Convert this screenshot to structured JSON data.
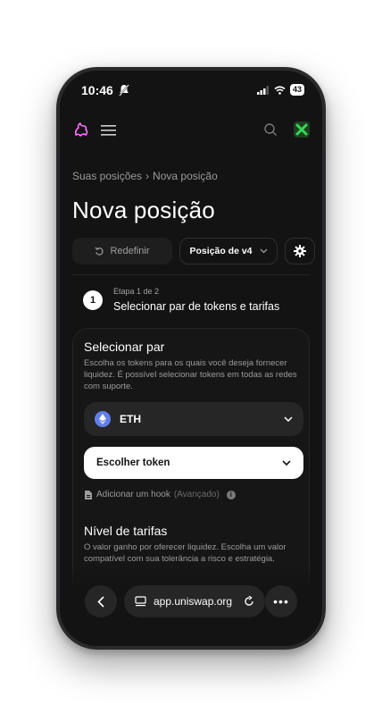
{
  "status": {
    "time": "10:46",
    "battery": "43"
  },
  "breadcrumb": {
    "parent": "Suas posições",
    "separator": "›",
    "current": "Nova posição"
  },
  "page_title": "Nova posição",
  "actions": {
    "reset_label": "Redefinir",
    "version_label": "Posição de v4"
  },
  "step": {
    "number": "1",
    "label": "Etapa 1 de 2",
    "name": "Selecionar par de tokens e tarifas"
  },
  "pair_section": {
    "heading": "Selecionar par",
    "description": "Escolha os tokens para os quais você deseja fornecer liquidez. É possível selecionar tokens em todas as redes com suporte.",
    "token_a": "ETH",
    "token_b_placeholder": "Escolher token",
    "hook_label": "Adicionar um hook",
    "hook_hint": "(Avançado)"
  },
  "fee_section": {
    "heading": "Nível de tarifas",
    "description": "O valor ganho por oferecer liquidez. Escolha um valor compatível com sua tolerância a risco e estratégia."
  },
  "browser": {
    "url": "app.uniswap.org"
  },
  "colors": {
    "background": "#131313",
    "accent_logo": "#fc72ff",
    "eth": "#627eea",
    "avatar": "#36d65b"
  }
}
